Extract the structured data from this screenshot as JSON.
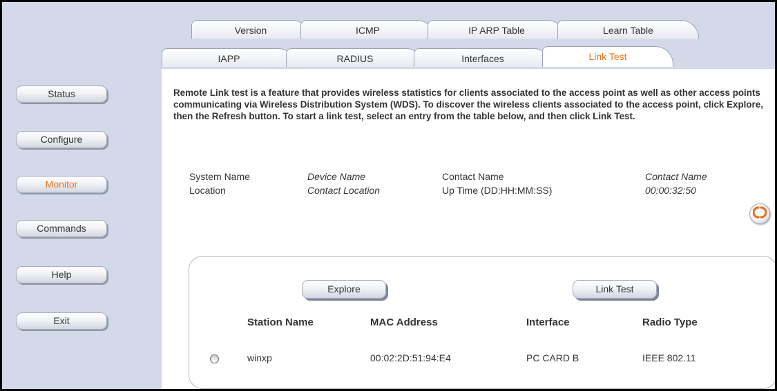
{
  "tabs": {
    "row1": [
      {
        "label": "Version"
      },
      {
        "label": "ICMP"
      },
      {
        "label": "IP ARP Table"
      },
      {
        "label": "Learn Table"
      }
    ],
    "row2": [
      {
        "label": "IAPP"
      },
      {
        "label": "RADIUS"
      },
      {
        "label": "Interfaces"
      },
      {
        "label": "Link Test",
        "active": true
      }
    ]
  },
  "sidebar": {
    "items": [
      {
        "label": "Status"
      },
      {
        "label": "Configure"
      },
      {
        "label": "Monitor",
        "active": true
      },
      {
        "label": "Commands"
      },
      {
        "label": "Help"
      },
      {
        "label": "Exit"
      }
    ]
  },
  "intro": "Remote Link test is a feature that provides wireless statistics for clients associated to the access point as well as other access points communicating via Wireless Distribution System (WDS). To discover the wireless clients associated to the access point, click Explore, then the Refresh button. To start a link test, select an entry from the table below, and then click Link Test.",
  "info": {
    "system_name_label": "System Name",
    "system_name_value": "Device Name",
    "location_label": "Location",
    "location_value": "Contact Location",
    "contact_name_label": "Contact Name",
    "contact_name_value": "Contact Name",
    "uptime_label": "Up Time (DD:HH:MM:SS)",
    "uptime_value": "00:00:32:50"
  },
  "refresh_icon": "refresh-icon",
  "panel": {
    "explore_label": "Explore",
    "linktest_label": "Link Test",
    "columns": [
      "Station Name",
      "MAC Address",
      "Interface",
      "Radio Type"
    ],
    "rows": [
      {
        "station": "winxp",
        "mac": "00:02:2D:51:94:E4",
        "interface": "PC CARD B",
        "radio": "IEEE 802.11",
        "selected": false
      }
    ]
  },
  "colors": {
    "accent": "#e8731b",
    "sidebar_bg": "#d3d9e9"
  }
}
